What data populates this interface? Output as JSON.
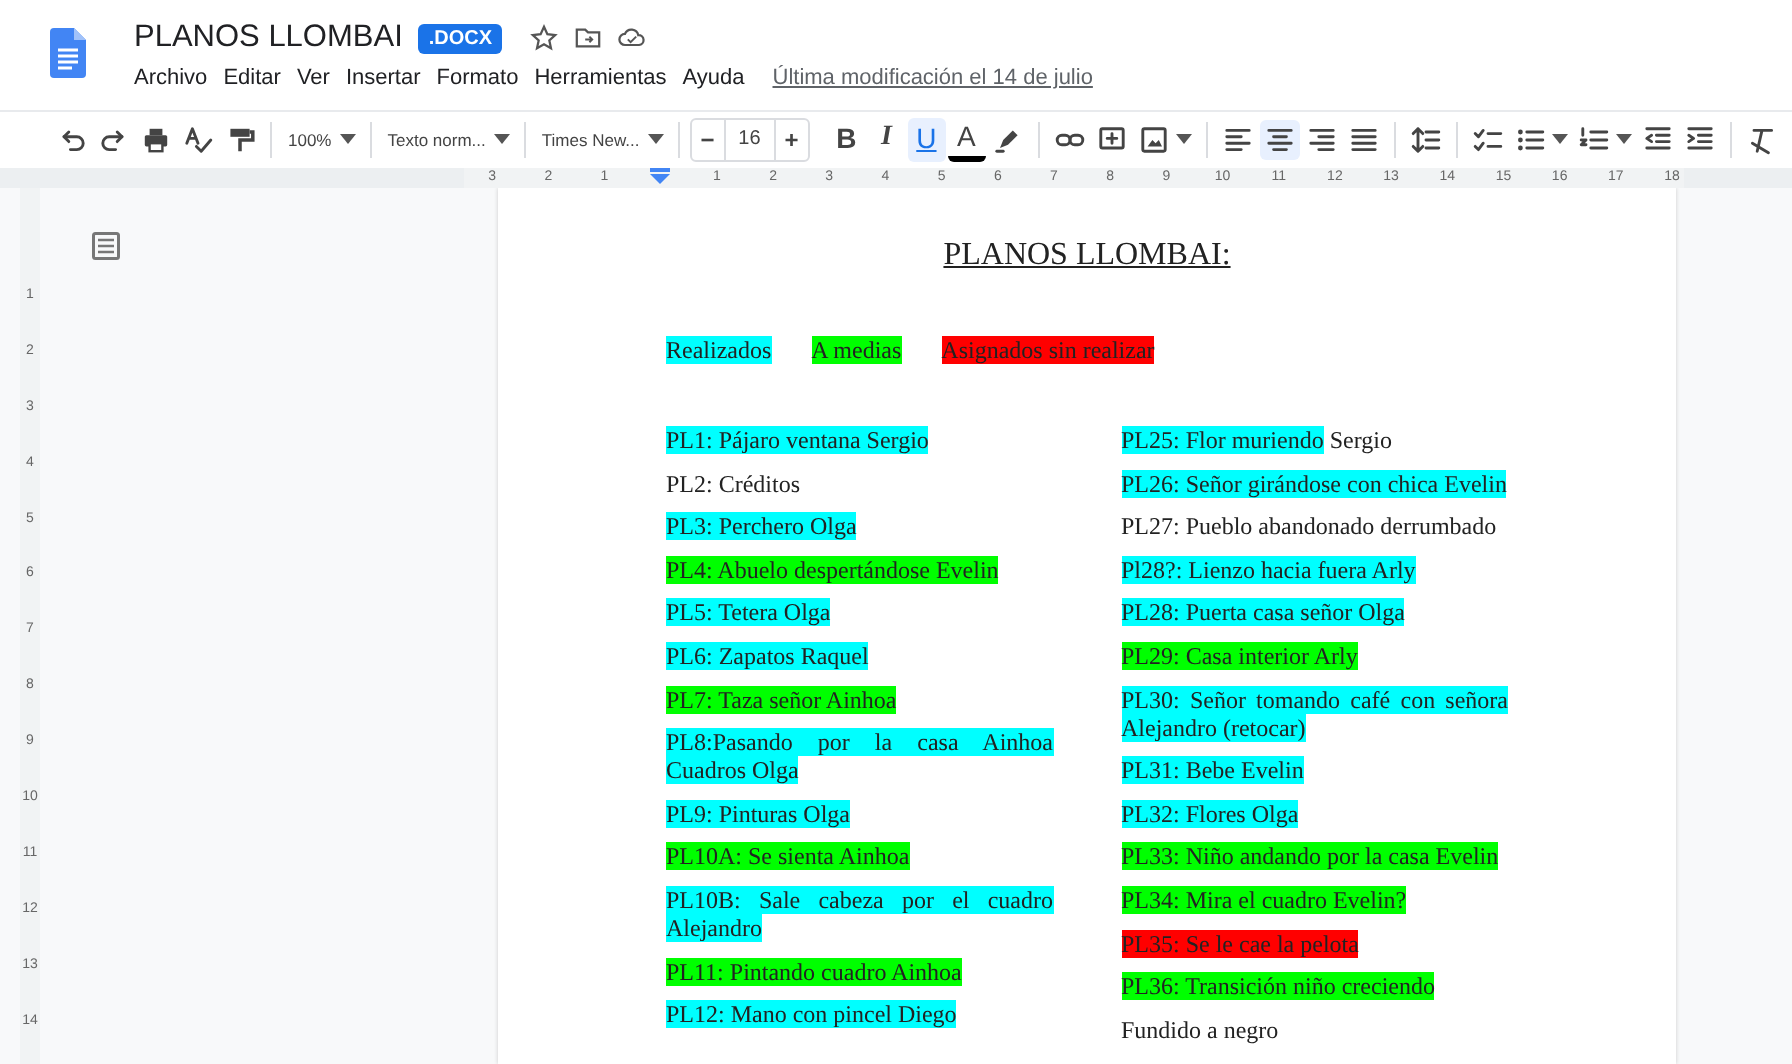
{
  "header": {
    "title": "PLANOS LLOMBAI",
    "badge": ".DOCX",
    "starred": false,
    "menu": [
      "Archivo",
      "Editar",
      "Ver",
      "Insertar",
      "Formato",
      "Herramientas",
      "Ayuda"
    ],
    "last_edit": "Última modificación el 14 de julio"
  },
  "toolbar": [
    {
      "kind": "icon"
    },
    {
      "kind": "icon"
    },
    {
      "kind": "icon"
    },
    {
      "kind": "icon"
    },
    {
      "kind": "icon"
    },
    {
      "kind": "separator"
    },
    {
      "kind": "dropdown",
      "text": "100%"
    },
    {
      "kind": "separator"
    },
    {
      "kind": "dropdown",
      "text": "Texto norm..."
    },
    {
      "kind": "separator"
    },
    {
      "kind": "dropdown",
      "text": "Times New..."
    },
    {
      "kind": "separator"
    },
    {
      "kind": "stepper",
      "minus": "−",
      "value": "16",
      "plus": "+"
    },
    {
      "kind": "toggle",
      "label": "B",
      "selected": false
    },
    {
      "kind": "toggle",
      "label": "I",
      "selected": false
    },
    {
      "kind": "toggle",
      "label": "U",
      "selected": true
    },
    {
      "kind": "toggle",
      "label": "A",
      "selected": false
    },
    {
      "kind": "icon"
    },
    {
      "kind": "separator"
    },
    {
      "kind": "icon"
    },
    {
      "kind": "icon"
    },
    {
      "kind": "icon-dropdown"
    },
    {
      "kind": "separator"
    },
    {
      "kind": "icon",
      "selected": false
    },
    {
      "kind": "icon",
      "selected": true
    },
    {
      "kind": "icon",
      "selected": false
    },
    {
      "kind": "icon",
      "selected": false
    },
    {
      "kind": "separator"
    },
    {
      "kind": "icon"
    },
    {
      "kind": "separator"
    },
    {
      "kind": "icon"
    },
    {
      "kind": "icon-dropdown"
    },
    {
      "kind": "icon-dropdown"
    },
    {
      "kind": "icon"
    },
    {
      "kind": "icon"
    },
    {
      "kind": "separator"
    },
    {
      "kind": "icon"
    }
  ],
  "ruler": {
    "left_labels": [
      "3",
      "2",
      "1"
    ],
    "labels": [
      "1",
      "2",
      "3",
      "4",
      "5",
      "6",
      "7",
      "8",
      "9",
      "10",
      "11",
      "12",
      "13",
      "14",
      "15",
      "16",
      "17",
      "18"
    ],
    "vertical_labels": [
      "1",
      "2",
      "3",
      "4",
      "5",
      "6",
      "7",
      "8",
      "9",
      "10",
      "11",
      "12",
      "13",
      "14"
    ]
  },
  "document": {
    "title": "PLANOS LLOMBAI:",
    "legend": [
      {
        "text": "Realizados",
        "color": "#00ffff"
      },
      {
        "text": "A medias",
        "color": "#00ff00"
      },
      {
        "text": "Asignados sin realizar",
        "color": "#ff0000"
      }
    ],
    "columns": [
      [
        {
          "text": "PL1: Pájaro ventana Sergio",
          "color": "#00ffff"
        },
        {
          "text": "PL2: Créditos"
        },
        {
          "text": "PL3: Perchero Olga",
          "color": "#00ffff"
        },
        {
          "text": "PL4: Abuelo despertándose Evelin",
          "color": "#00ff00"
        },
        {
          "text": "PL5: Tetera Olga",
          "color": "#00ffff"
        },
        {
          "text": "PL6: Zapatos Raquel",
          "color": "#00ffff"
        },
        {
          "text": "PL7: Taza señor Ainhoa",
          "color": "#00ff00"
        },
        {
          "text": "PL8:Pasando por la casa Ainhoa Cuadros Olga",
          "color": "#00ffff"
        },
        {
          "text": "PL9: Pinturas Olga",
          "color": "#00ffff"
        },
        {
          "text": "PL10A: Se sienta Ainhoa",
          "color": "#00ff00"
        },
        {
          "text": "PL10B: Sale cabeza por el cuadro Alejandro",
          "color": "#00ffff"
        },
        {
          "text": "PL11: Pintando cuadro Ainhoa",
          "color": "#00ff00"
        },
        {
          "text": "PL12: Mano con pincel Diego",
          "color": "#00ffff"
        }
      ],
      [
        {
          "text": "PL25: Flor muriendo",
          "color": "#00ffff",
          "tail": "Sergio"
        },
        {
          "text": "PL26: Señor girándose con chica Evelin",
          "color": "#00ffff"
        },
        {
          "text": "PL27: Pueblo abandonado derrumbado"
        },
        {
          "text": "Pl28?: Lienzo hacia fuera Arly",
          "color": "#00ffff"
        },
        {
          "text": "PL28: Puerta casa señor Olga",
          "color": "#00ffff"
        },
        {
          "text": "PL29: Casa interior Arly",
          "color": "#00ff00"
        },
        {
          "text": "PL30: Señor tomando café con señora Alejandro (retocar)",
          "color": "#00ffff"
        },
        {
          "text": "PL31: Bebe Evelin",
          "color": "#00ffff"
        },
        {
          "text": "PL32: Flores Olga",
          "color": "#00ffff"
        },
        {
          "text": "PL33: Niño andando por la casa Evelin",
          "color": "#00ff00"
        },
        {
          "text": "PL34: Mira el cuadro Evelin?",
          "color": "#00ff00"
        },
        {
          "text": "PL35: Se le cae la pelota",
          "color": "#ff0000"
        },
        {
          "text": "PL36: Transición niño creciendo",
          "color": "#00ff00"
        },
        {
          "text": "Fundido a negro"
        }
      ]
    ]
  }
}
